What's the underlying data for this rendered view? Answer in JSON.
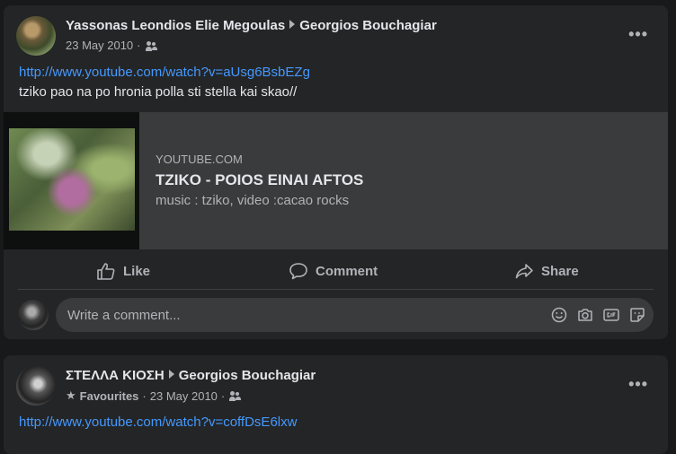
{
  "posts": [
    {
      "author": "Yassonas Leondios Elie Megoulas",
      "target": "Georgios Bouchagiar",
      "date": "23 May 2010",
      "more": "•••",
      "link": "http://www.youtube.com/watch?v=aUsg6BsbEZg",
      "text": "tziko pao na po hronia polla sti stella kai skao//",
      "preview": {
        "site": "YOUTUBE.COM",
        "title": "TZIKO - POIOS EINAI AFTOS",
        "description": "music : tziko, video :cacao rocks"
      },
      "actions": {
        "like": "Like",
        "comment": "Comment",
        "share": "Share"
      },
      "comment_placeholder": "Write a comment..."
    },
    {
      "author": "ΣΤΕΛΛΑ ΚΙΟΣΗ",
      "target": "Georgios Bouchagiar",
      "favourites": "Favourites",
      "separator": "·",
      "date": "23 May 2010",
      "more": "•••",
      "link": "http://www.youtube.com/watch?v=coffDsE6lxw"
    }
  ],
  "colors": {
    "background": "#18191a",
    "card": "#242526",
    "link": "#4599ff",
    "secondary_text": "#b0b3b8"
  }
}
